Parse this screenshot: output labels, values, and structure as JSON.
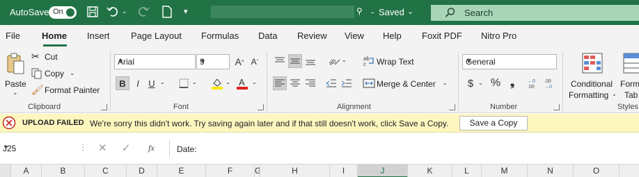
{
  "titlebar": {
    "autosave_label": "AutoSave",
    "autosave_state": "On",
    "status": "Saved",
    "search_placeholder": "Search"
  },
  "menu": {
    "tabs": [
      "File",
      "Home",
      "Insert",
      "Page Layout",
      "Formulas",
      "Data",
      "Review",
      "View",
      "Help",
      "Foxit PDF",
      "Nitro Pro"
    ],
    "active": "Home"
  },
  "ribbon": {
    "clipboard": {
      "label": "Clipboard",
      "paste": "Paste",
      "cut": "Cut",
      "copy": "Copy",
      "format_painter": "Format Painter"
    },
    "font": {
      "label": "Font",
      "font_name": "Arial",
      "font_size": "9",
      "bold": "B",
      "italic": "I",
      "underline": "U"
    },
    "alignment": {
      "label": "Alignment",
      "wrap_text": "Wrap Text",
      "merge_center": "Merge & Center"
    },
    "number": {
      "label": "Number",
      "format": "General"
    },
    "styles": {
      "label": "Styles",
      "conditional_line1": "Conditional",
      "conditional_line2": "Formatting",
      "format_as_table_line1": "Form",
      "format_as_table_line2": "Tab"
    }
  },
  "infobar": {
    "title": "UPLOAD FAILED",
    "message": "We're sorry this didn't work. Try saving again later and if that still doesn't work, click Save a Copy.",
    "button": "Save a Copy"
  },
  "formulabar": {
    "cell_ref": "J25",
    "fx": "fx",
    "content": "Date:"
  },
  "columns": [
    "A",
    "B",
    "C",
    "D",
    "E",
    "F",
    "G",
    "H",
    "I",
    "J",
    "K",
    "L",
    "M",
    "N",
    "O"
  ],
  "selected_column": "J",
  "colors": {
    "brand": "#217346",
    "infobar": "#fdf6bf",
    "font_highlight": "#ffe600",
    "font_color": "#e0201b"
  }
}
